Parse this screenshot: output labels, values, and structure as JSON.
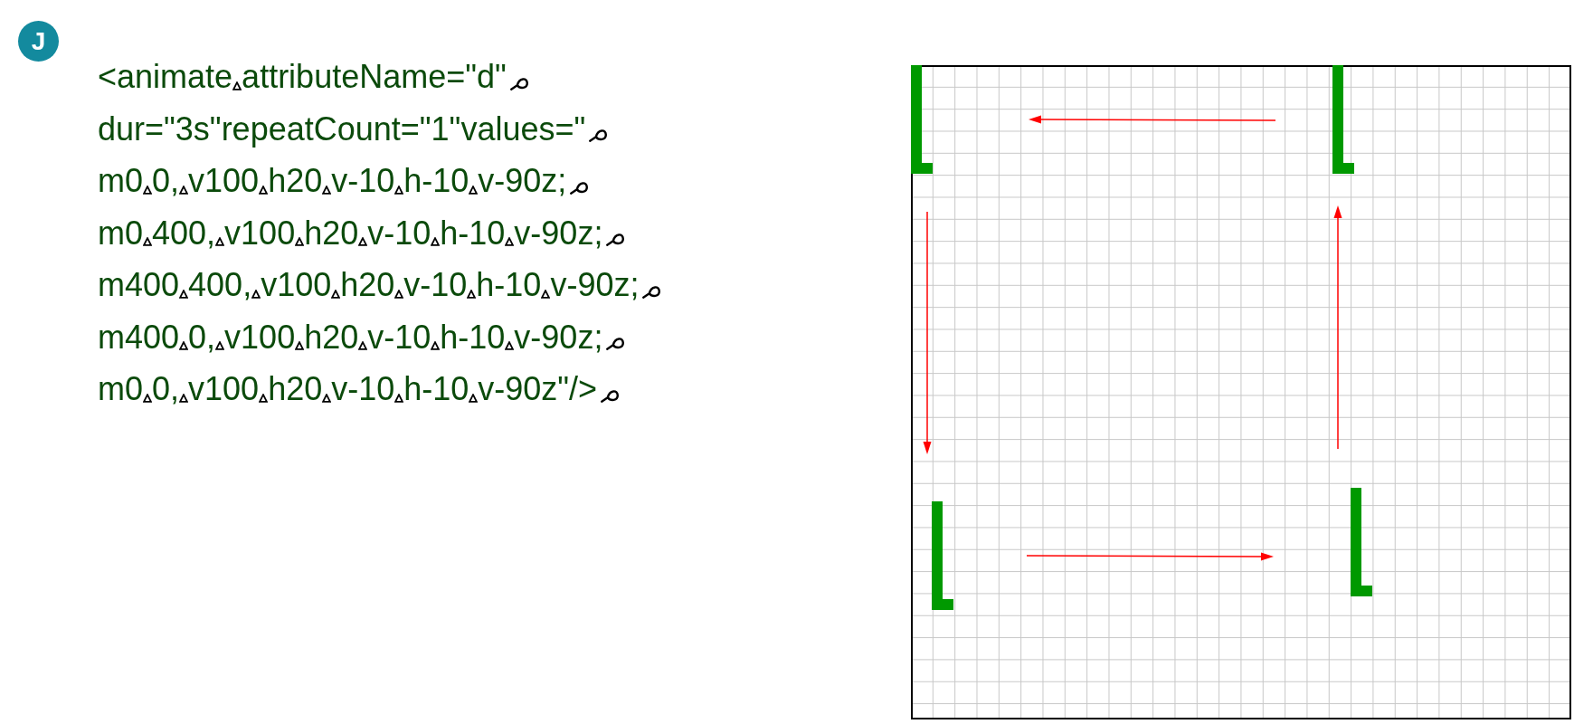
{
  "badge": {
    "letter": "J"
  },
  "code_lines": [
    {
      "tokens": [
        "<animate",
        "attributeName=\"d\""
      ]
    },
    {
      "tokens": [
        "dur=\"3s\"repeatCount=\"1\"values=\""
      ]
    },
    {
      "tokens": [
        "m0",
        "0,",
        "v100",
        "h20",
        "v-10",
        "h-10",
        "v-90z;"
      ]
    },
    {
      "tokens": [
        "m0",
        "400,",
        "v100",
        "h20",
        "v-10",
        "h-10",
        "v-90z;"
      ]
    },
    {
      "tokens": [
        "m400",
        "400,",
        "v100",
        "h20",
        "v-10",
        "h-10",
        "v-90z;"
      ]
    },
    {
      "tokens": [
        "m400",
        "0,",
        "v100",
        "h20",
        "v-10",
        "h-10",
        "v-90z;"
      ]
    },
    {
      "tokens": [
        "m0",
        "0,",
        "v100",
        "h20",
        "v-10",
        "h-10",
        "v-90z\"/>"
      ]
    }
  ]
}
